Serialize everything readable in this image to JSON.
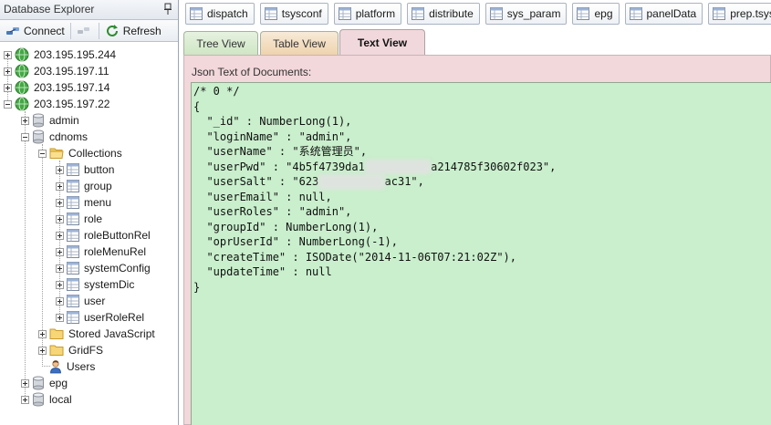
{
  "explorer": {
    "title": "Database Explorer",
    "connect_label": "Connect",
    "refresh_label": "Refresh"
  },
  "tree": {
    "servers": [
      "203.195.195.244",
      "203.195.197.11",
      "203.195.197.14",
      "203.195.197.22"
    ],
    "databases": [
      "admin",
      "cdnoms",
      "epg",
      "local"
    ],
    "collections_label": "Collections",
    "collections": [
      "button",
      "group",
      "menu",
      "role",
      "roleButtonRel",
      "roleMenuRel",
      "systemConfig",
      "systemDic",
      "user",
      "userRoleRel"
    ],
    "stored_js_label": "Stored JavaScript",
    "gridfs_label": "GridFS",
    "users_label": "Users"
  },
  "collection_tabs": [
    "dispatch",
    "tsysconf",
    "platform",
    "distribute",
    "sys_param",
    "epg",
    "panelData",
    "prep.tsysconf"
  ],
  "view_tabs": {
    "tree": "Tree View",
    "table": "Table View",
    "text": "Text View",
    "active": "Text View"
  },
  "json_panel": {
    "label": "Json Text of Documents:",
    "lines": [
      "/* 0 */",
      "{",
      "  \"_id\" : NumberLong(1),",
      "  \"loginName\" : \"admin\",",
      "  \"userName\" : \"系统管理员\",",
      "  \"userPwd\" : \"4b5f4739da1",
      "  \"userSalt\" : \"623",
      "  \"userEmail\" : null,",
      "  \"userRoles\" : \"admin\",",
      "  \"groupId\" : NumberLong(1),",
      "  \"oprUserId\" : NumberLong(-1),",
      "  \"createTime\" : ISODate(\"2014-11-06T07:21:02Z\"),",
      "  \"updateTime\" : null",
      "}"
    ],
    "pwd_tail": "a214785f30602f023\",",
    "salt_tail": "ac31\","
  },
  "colors": {
    "json_background": "#c9efcc",
    "text_tab_background": "#f1d8dc",
    "server_icon": "#3aa03a"
  }
}
